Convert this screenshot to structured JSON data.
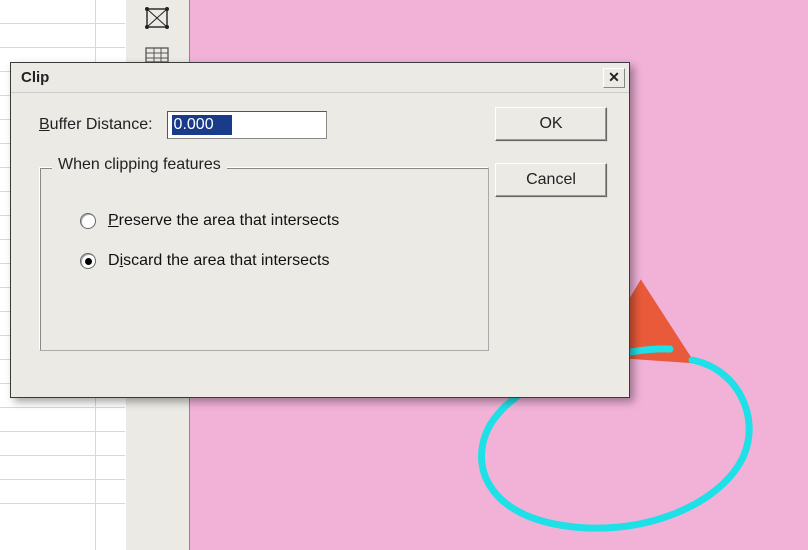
{
  "dialog": {
    "title": "Clip",
    "buffer_label_pre": "B",
    "buffer_label_rest": "uffer Distance:",
    "buffer_value": "0.000",
    "ok_label": "OK",
    "cancel_label": "Cancel",
    "groupbox_title": "When clipping features",
    "radios": {
      "preserve_pre": "P",
      "preserve_rest": "reserve the area that intersects",
      "discard_pre": "D",
      "discard_mid": "i",
      "discard_rest": "scard the area that intersects",
      "selected": "discard"
    }
  },
  "icons": {
    "close": "✕"
  }
}
